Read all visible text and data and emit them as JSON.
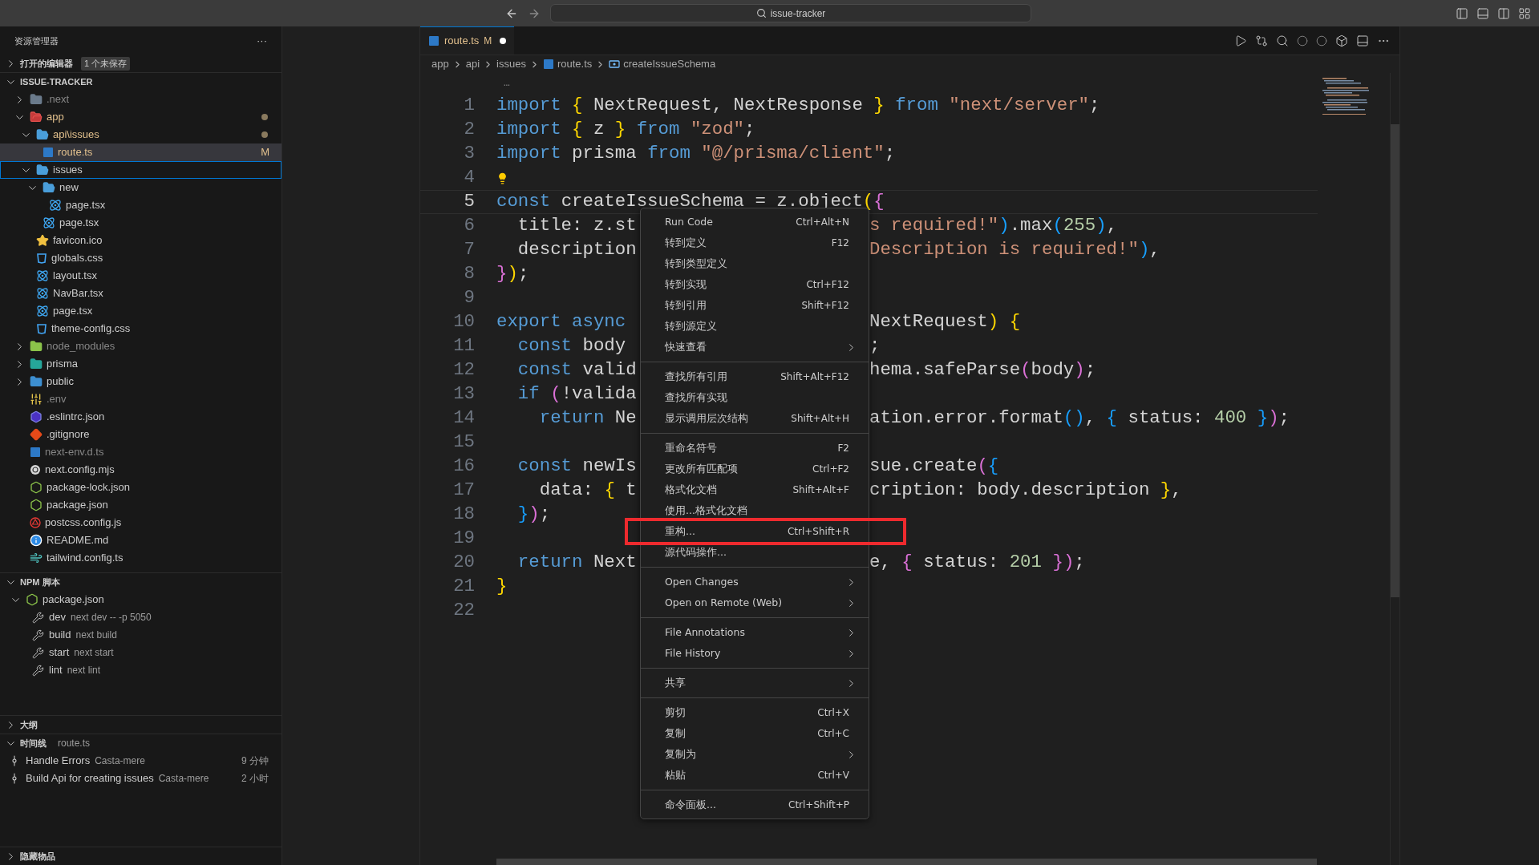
{
  "title_bar": {
    "search": "issue-tracker"
  },
  "sidebar": {
    "title": "资源管理器",
    "more": "···",
    "open_editors": {
      "label": "打开的编辑器",
      "badge": "1 个未保存",
      "expanded": false
    },
    "project": {
      "label": "ISSUE-TRACKER",
      "expanded": true
    },
    "tree": [
      {
        "name": ".next",
        "kind": "folder",
        "expanded": false,
        "modified": false,
        "ignored": true,
        "selected": false,
        "focused": false
      },
      {
        "name": "app",
        "kind": "folder",
        "expanded": true,
        "modified": true,
        "ignored": false,
        "selected": false,
        "focused": false,
        "children": [
          {
            "name": "api\\issues",
            "kind": "folder",
            "expanded": true,
            "modified": true,
            "ignored": false,
            "selected": false,
            "focused": false,
            "children": [
              {
                "name": "route.ts",
                "kind": "ts",
                "modified": true,
                "ignored": false,
                "badge": "M",
                "selected": true,
                "focused": false
              }
            ]
          },
          {
            "name": "issues",
            "kind": "folder",
            "expanded": true,
            "modified": false,
            "ignored": false,
            "selected": false,
            "focused": true,
            "children": [
              {
                "name": "new",
                "kind": "folder",
                "expanded": true,
                "modified": false,
                "ignored": false,
                "selected": false,
                "focused": false,
                "children": [
                  {
                    "name": "page.tsx",
                    "kind": "react",
                    "modified": false,
                    "ignored": false,
                    "selected": false,
                    "focused": false
                  }
                ]
              },
              {
                "name": "page.tsx",
                "kind": "react",
                "modified": false,
                "ignored": false,
                "selected": false,
                "focused": false
              }
            ]
          },
          {
            "name": "favicon.ico",
            "kind": "star",
            "modified": false,
            "ignored": false,
            "selected": false,
            "focused": false
          },
          {
            "name": "globals.css",
            "kind": "css",
            "modified": false,
            "ignored": false,
            "selected": false,
            "focused": false
          },
          {
            "name": "layout.tsx",
            "kind": "react",
            "modified": false,
            "ignored": false,
            "selected": false,
            "focused": false
          },
          {
            "name": "NavBar.tsx",
            "kind": "react",
            "modified": false,
            "ignored": false,
            "selected": false,
            "focused": false
          },
          {
            "name": "page.tsx",
            "kind": "react",
            "modified": false,
            "ignored": false,
            "selected": false,
            "focused": false
          },
          {
            "name": "theme-config.css",
            "kind": "css",
            "modified": false,
            "ignored": false,
            "selected": false,
            "focused": false
          }
        ]
      },
      {
        "name": "node_modules",
        "kind": "folder",
        "expanded": false,
        "modified": false,
        "ignored": true,
        "selected": false,
        "focused": false
      },
      {
        "name": "prisma",
        "kind": "folder",
        "expanded": false,
        "modified": false,
        "ignored": false,
        "selected": false,
        "focused": false
      },
      {
        "name": "public",
        "kind": "folder",
        "expanded": false,
        "modified": false,
        "ignored": false,
        "selected": false,
        "focused": false
      },
      {
        "name": ".env",
        "kind": "env",
        "modified": false,
        "ignored": true,
        "selected": false,
        "focused": false
      },
      {
        "name": ".eslintrc.json",
        "kind": "eslint",
        "modified": false,
        "ignored": false,
        "selected": false,
        "focused": false
      },
      {
        "name": ".gitignore",
        "kind": "git",
        "modified": false,
        "ignored": false,
        "selected": false,
        "focused": false
      },
      {
        "name": "next-env.d.ts",
        "kind": "ts",
        "modified": false,
        "ignored": true,
        "selected": false,
        "focused": false
      },
      {
        "name": "next.config.mjs",
        "kind": "next",
        "modified": false,
        "ignored": false,
        "selected": false,
        "focused": false
      },
      {
        "name": "package-lock.json",
        "kind": "npm",
        "modified": false,
        "ignored": false,
        "selected": false,
        "focused": false
      },
      {
        "name": "package.json",
        "kind": "npm",
        "modified": false,
        "ignored": false,
        "selected": false,
        "focused": false
      },
      {
        "name": "postcss.config.js",
        "kind": "postcss",
        "modified": false,
        "ignored": false,
        "selected": false,
        "focused": false
      },
      {
        "name": "README.md",
        "kind": "info",
        "modified": false,
        "ignored": false,
        "selected": false,
        "focused": false
      },
      {
        "name": "tailwind.config.ts",
        "kind": "tailwind",
        "modified": false,
        "ignored": false,
        "selected": false,
        "focused": false
      }
    ],
    "npm": {
      "label": "NPM 脚本",
      "expanded": true,
      "file": "package.json",
      "scripts": [
        {
          "name": "dev",
          "command": "next dev -- -p 5050"
        },
        {
          "name": "build",
          "command": "next build"
        },
        {
          "name": "start",
          "command": "next start"
        },
        {
          "name": "lint",
          "command": "next lint"
        }
      ]
    },
    "outline": {
      "label": "大纲",
      "expanded": false
    },
    "timeline": {
      "label": "时间线",
      "file": "route.ts",
      "expanded": true,
      "entries": [
        {
          "message": "Handle Errors",
          "author": "Casta-mere",
          "time": "9 分钟"
        },
        {
          "message": "Build Api for creating issues",
          "author": "Casta-mere",
          "time": "2 小时"
        }
      ]
    },
    "hidden": {
      "label": "隐藏物品",
      "expanded": false
    }
  },
  "editor": {
    "tab": {
      "name": "route.ts",
      "badge": "M",
      "unsaved": true
    },
    "breadcrumb": [
      "app",
      "api",
      "issues",
      "route.ts",
      "createIssueSchema"
    ],
    "sticky": "…",
    "lines": [
      {
        "n": "1",
        "code": [
          {
            "t": "import ",
            "kind": "keyword"
          },
          {
            "t": "{",
            "kind": "bracket1"
          },
          {
            "t": " NextRequest, NextResponse ",
            "kind": "plain"
          },
          {
            "t": "} ",
            "kind": "bracket1"
          },
          {
            "t": "from ",
            "kind": "keyword"
          },
          {
            "t": "\"next/server\"",
            "kind": "string"
          },
          {
            "t": ";",
            "kind": "plain"
          }
        ]
      },
      {
        "n": "2",
        "code": [
          {
            "t": "import ",
            "kind": "keyword"
          },
          {
            "t": "{",
            "kind": "bracket1"
          },
          {
            "t": " z ",
            "kind": "plain"
          },
          {
            "t": "} ",
            "kind": "bracket1"
          },
          {
            "t": "from ",
            "kind": "keyword"
          },
          {
            "t": "\"zod\"",
            "kind": "string"
          },
          {
            "t": ";",
            "kind": "plain"
          }
        ]
      },
      {
        "n": "3",
        "code": [
          {
            "t": "import ",
            "kind": "keyword"
          },
          {
            "t": "prisma ",
            "kind": "plain"
          },
          {
            "t": "from ",
            "kind": "keyword"
          },
          {
            "t": "\"@/prisma/client\"",
            "kind": "string"
          },
          {
            "t": ";",
            "kind": "plain"
          }
        ]
      },
      {
        "n": "4",
        "lightbulb": true
      },
      {
        "n": "5",
        "code": [
          {
            "t": "const ",
            "kind": "keyword"
          },
          {
            "t": "createIssueSchema = z.object",
            "kind": "plain"
          },
          {
            "t": "(",
            "kind": "bracket1"
          },
          {
            "t": "{",
            "kind": "bracket2"
          }
        ],
        "current": true
      },
      {
        "n": "6",
        "code": [
          {
            "t": "  title: z.st",
            "kind": "plain"
          }
        ],
        "right": [
          {
            "t": "s required!\"",
            "kind": "string"
          },
          {
            "t": ")",
            "kind": "bracket3"
          },
          {
            "t": ".max",
            "kind": "plain"
          },
          {
            "t": "(",
            "kind": "bracket3"
          },
          {
            "t": "255",
            "kind": "number"
          },
          {
            "t": ")",
            "kind": "bracket3"
          },
          {
            "t": ",",
            "kind": "plain"
          }
        ]
      },
      {
        "n": "7",
        "code": [
          {
            "t": "  description",
            "kind": "plain"
          }
        ],
        "right": [
          {
            "t": "Description is required!\"",
            "kind": "string"
          },
          {
            "t": ")",
            "kind": "bracket3"
          },
          {
            "t": ",",
            "kind": "plain"
          }
        ]
      },
      {
        "n": "8",
        "code": [
          {
            "t": "}",
            "kind": "bracket2"
          },
          {
            "t": ")",
            "kind": "bracket1"
          },
          {
            "t": ";",
            "kind": "plain"
          }
        ]
      },
      {
        "n": "9"
      },
      {
        "n": "10",
        "code": [
          {
            "t": "export async ",
            "kind": "keyword"
          }
        ],
        "right": [
          {
            "t": "NextRequest",
            "kind": "plain"
          },
          {
            "t": ") ",
            "kind": "bracket1"
          },
          {
            "t": "{",
            "kind": "bracket1"
          }
        ]
      },
      {
        "n": "11",
        "code": [
          {
            "t": "  const ",
            "kind": "keyword"
          },
          {
            "t": "body ",
            "kind": "plain"
          }
        ],
        "right": [
          {
            "t": ";",
            "kind": "plain"
          }
        ]
      },
      {
        "n": "12",
        "code": [
          {
            "t": "  const ",
            "kind": "keyword"
          },
          {
            "t": "valid",
            "kind": "plain"
          }
        ],
        "right": [
          {
            "t": "hema.safeParse",
            "kind": "plain"
          },
          {
            "t": "(",
            "kind": "bracket2"
          },
          {
            "t": "body",
            "kind": "plain"
          },
          {
            "t": ")",
            "kind": "bracket2"
          },
          {
            "t": ";",
            "kind": "plain"
          }
        ]
      },
      {
        "n": "13",
        "code": [
          {
            "t": "  if ",
            "kind": "keyword"
          },
          {
            "t": "(",
            "kind": "bracket2"
          },
          {
            "t": "!valida",
            "kind": "plain"
          }
        ]
      },
      {
        "n": "14",
        "code": [
          {
            "t": "    return ",
            "kind": "keyword"
          },
          {
            "t": "Ne",
            "kind": "plain"
          }
        ],
        "right": [
          {
            "t": "ation.error.format",
            "kind": "plain"
          },
          {
            "t": "()",
            "kind": "bracket3"
          },
          {
            "t": ", ",
            "kind": "plain"
          },
          {
            "t": "{",
            "kind": "bracket3"
          },
          {
            "t": " status: ",
            "kind": "plain"
          },
          {
            "t": "400 ",
            "kind": "number"
          },
          {
            "t": "}",
            "kind": "bracket3"
          },
          {
            "t": ")",
            "kind": "bracket2"
          },
          {
            "t": ";",
            "kind": "plain"
          }
        ]
      },
      {
        "n": "15"
      },
      {
        "n": "16",
        "code": [
          {
            "t": "  const ",
            "kind": "keyword"
          },
          {
            "t": "newIs",
            "kind": "plain"
          }
        ],
        "right": [
          {
            "t": "sue.create",
            "kind": "plain"
          },
          {
            "t": "(",
            "kind": "bracket2"
          },
          {
            "t": "{",
            "kind": "bracket3"
          }
        ]
      },
      {
        "n": "17",
        "code": [
          {
            "t": "    data: ",
            "kind": "plain"
          },
          {
            "t": "{",
            "kind": "bracket1"
          },
          {
            "t": " t",
            "kind": "plain"
          }
        ],
        "right": [
          {
            "t": "cription: body.description ",
            "kind": "plain"
          },
          {
            "t": "}",
            "kind": "bracket1"
          },
          {
            "t": ",",
            "kind": "plain"
          }
        ]
      },
      {
        "n": "18",
        "code": [
          {
            "t": "  }",
            "kind": "bracket3"
          },
          {
            "t": ")",
            "kind": "bracket2"
          },
          {
            "t": ";",
            "kind": "plain"
          }
        ]
      },
      {
        "n": "19"
      },
      {
        "n": "20",
        "code": [
          {
            "t": "  return ",
            "kind": "keyword"
          },
          {
            "t": "Next",
            "kind": "plain"
          }
        ],
        "right": [
          {
            "t": "e, ",
            "kind": "plain"
          },
          {
            "t": "{",
            "kind": "bracket2"
          },
          {
            "t": " status: ",
            "kind": "plain"
          },
          {
            "t": "201 ",
            "kind": "number"
          },
          {
            "t": "}",
            "kind": "bracket2"
          },
          {
            "t": ")",
            "kind": "bracket2"
          },
          {
            "t": ";",
            "kind": "plain"
          }
        ]
      },
      {
        "n": "21",
        "code": [
          {
            "t": "}",
            "kind": "bracket1"
          }
        ]
      },
      {
        "n": "22"
      }
    ]
  },
  "context_menu": {
    "groups": [
      [
        {
          "label": "Run Code",
          "shortcut": "Ctrl+Alt+N",
          "submenu": false,
          "highlighted": false
        },
        {
          "label": "转到定义",
          "shortcut": "F12",
          "submenu": false,
          "highlighted": false
        },
        {
          "label": "转到类型定义",
          "submenu": false,
          "highlighted": false
        },
        {
          "label": "转到实现",
          "shortcut": "Ctrl+F12",
          "submenu": false,
          "highlighted": false
        },
        {
          "label": "转到引用",
          "shortcut": "Shift+F12",
          "submenu": false,
          "highlighted": false
        },
        {
          "label": "转到源定义",
          "submenu": false,
          "highlighted": false
        },
        {
          "label": "快速查看",
          "submenu": true,
          "highlighted": false
        }
      ],
      [
        {
          "label": "查找所有引用",
          "shortcut": "Shift+Alt+F12",
          "submenu": false,
          "highlighted": false
        },
        {
          "label": "查找所有实现",
          "submenu": false,
          "highlighted": false
        },
        {
          "label": "显示调用层次结构",
          "shortcut": "Shift+Alt+H",
          "submenu": false,
          "highlighted": false
        }
      ],
      [
        {
          "label": "重命名符号",
          "shortcut": "F2",
          "submenu": false,
          "highlighted": false
        },
        {
          "label": "更改所有匹配项",
          "shortcut": "Ctrl+F2",
          "submenu": false,
          "highlighted": false
        },
        {
          "label": "格式化文档",
          "shortcut": "Shift+Alt+F",
          "submenu": false,
          "highlighted": false
        },
        {
          "label": "使用...格式化文档",
          "submenu": false,
          "highlighted": false
        },
        {
          "label": "重构...",
          "shortcut": "Ctrl+Shift+R",
          "submenu": false,
          "highlighted": true
        },
        {
          "label": "源代码操作...",
          "submenu": false,
          "highlighted": false
        }
      ],
      [
        {
          "label": "Open Changes",
          "submenu": true,
          "highlighted": false
        },
        {
          "label": "Open on Remote (Web)",
          "submenu": true,
          "highlighted": false
        }
      ],
      [
        {
          "label": "File Annotations",
          "submenu": true,
          "highlighted": false
        },
        {
          "label": "File History",
          "submenu": true,
          "highlighted": false
        }
      ],
      [
        {
          "label": "共享",
          "submenu": true,
          "highlighted": false
        }
      ],
      [
        {
          "label": "剪切",
          "shortcut": "Ctrl+X",
          "submenu": false,
          "highlighted": false
        },
        {
          "label": "复制",
          "shortcut": "Ctrl+C",
          "submenu": false,
          "highlighted": false
        },
        {
          "label": "复制为",
          "submenu": true,
          "highlighted": false
        },
        {
          "label": "粘贴",
          "shortcut": "Ctrl+V",
          "submenu": false,
          "highlighted": false
        }
      ],
      [
        {
          "label": "命令面板...",
          "shortcut": "Ctrl+Shift+P",
          "submenu": false,
          "highlighted": false
        }
      ]
    ]
  }
}
